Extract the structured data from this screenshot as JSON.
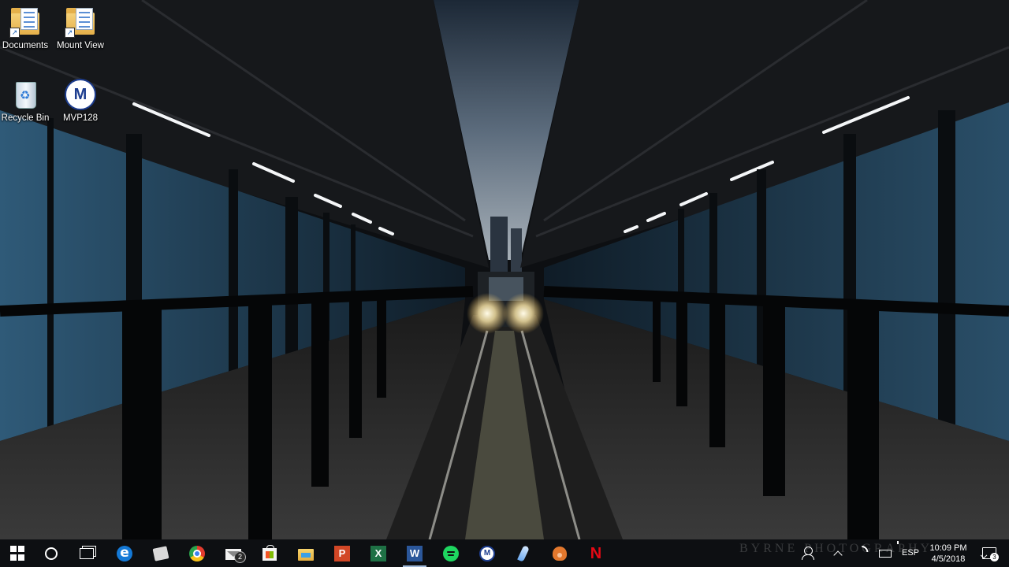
{
  "desktop": {
    "icons": [
      {
        "label": "Documents"
      },
      {
        "label": "Mount View"
      },
      {
        "label": "Recycle Bin"
      },
      {
        "label": "MVP128"
      }
    ],
    "wallpaper_watermark": "BYRNE PHOTOGRAPHY"
  },
  "taskbar": {
    "mail_badge": "2",
    "apps": [
      {
        "name": "Microsoft Edge",
        "icon": "edge-icon",
        "glyph": "e"
      },
      {
        "name": "Snipping Tool",
        "icon": "tool-icon"
      },
      {
        "name": "Google Chrome",
        "icon": "chrome-icon"
      },
      {
        "name": "Mail",
        "icon": "mail-icon"
      },
      {
        "name": "Microsoft Store",
        "icon": "store-icon"
      },
      {
        "name": "File Explorer",
        "icon": "folder-icon"
      },
      {
        "name": "PowerPoint",
        "icon": "powerpoint-icon",
        "glyph": "P"
      },
      {
        "name": "Excel",
        "icon": "excel-icon",
        "glyph": "X"
      },
      {
        "name": "Word",
        "icon": "word-icon",
        "glyph": "W"
      },
      {
        "name": "Spotify",
        "icon": "spotify-icon"
      },
      {
        "name": "School app",
        "icon": "school-logo-icon"
      },
      {
        "name": "Feather app",
        "icon": "feather-icon"
      },
      {
        "name": "Fox app",
        "icon": "fox-icon"
      },
      {
        "name": "Netflix",
        "icon": "netflix-icon",
        "glyph": "N"
      }
    ]
  },
  "tray": {
    "language": "ESP",
    "time": "10:09 PM",
    "date": "4/5/2018",
    "notification_count": "3"
  },
  "desktop_icon_glyphs": {
    "school_logo": "M",
    "shortcut_arrow": "↗"
  }
}
